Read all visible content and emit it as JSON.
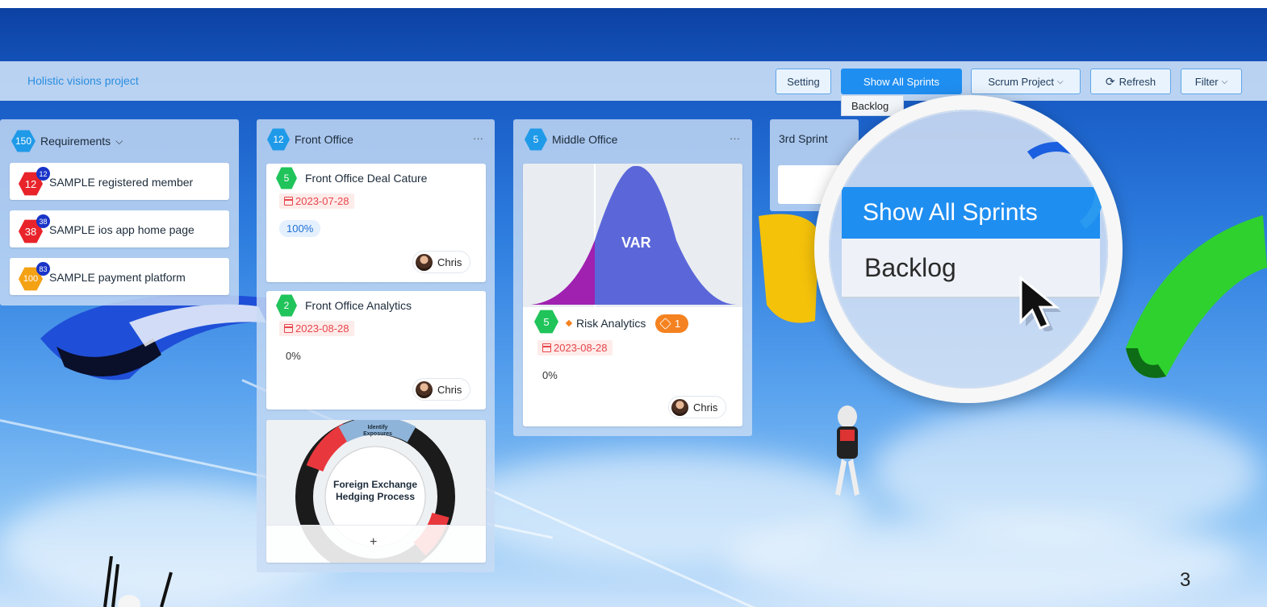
{
  "header": {
    "project_title": "Holistic visions project"
  },
  "toolbar": {
    "setting": "Setting",
    "show_all_sprints": "Show All Sprints",
    "scrum_project": "Scrum Project",
    "refresh": "Refresh",
    "filter": "Filter"
  },
  "dropdown": {
    "backlog": "Backlog"
  },
  "requirements": {
    "count": "150",
    "title": "Requirements",
    "items": [
      {
        "hex": "12",
        "badge": "12",
        "label": "SAMPLE registered member",
        "color": "#e8232a"
      },
      {
        "hex": "38",
        "badge": "38",
        "label": "SAMPLE ios app home page",
        "color": "#e8232a"
      },
      {
        "hex": "100",
        "badge": "83",
        "label": "SAMPLE payment platform",
        "color": "#f4a114"
      }
    ]
  },
  "front_office": {
    "count": "12",
    "title": "Front Office",
    "more": "···",
    "cards": [
      {
        "points": "5",
        "title": "Front Office Deal Cature",
        "date": "2023-07-28",
        "progress": "100%",
        "assignee": "Chris"
      },
      {
        "points": "2",
        "title": "Front Office Analytics",
        "date": "2023-08-28",
        "progress": "0%",
        "assignee": "Chris"
      }
    ],
    "image_card": {
      "top": "Identify Exposures",
      "center_line1": "Foreign Exchange",
      "center_line2": "Hedging Process",
      "add": "+"
    }
  },
  "middle_office": {
    "count": "5",
    "title": "Middle Office",
    "more": "···",
    "card": {
      "image_label": "VAR",
      "points": "5",
      "title": "Risk Analytics",
      "tag_count": "1",
      "date": "2023-08-28",
      "progress": "0%",
      "assignee": "Chris"
    }
  },
  "third_sprint": {
    "title": "3rd Sprint"
  },
  "magnifier": {
    "show_all_sprints": "Show All Sprints",
    "backlog": "Backlog"
  },
  "page_number": "3",
  "colors": {
    "accent": "#1f8ef1",
    "date_red": "#e8454b",
    "green_hex": "#20c45a",
    "orange_tag": "#f58220"
  }
}
